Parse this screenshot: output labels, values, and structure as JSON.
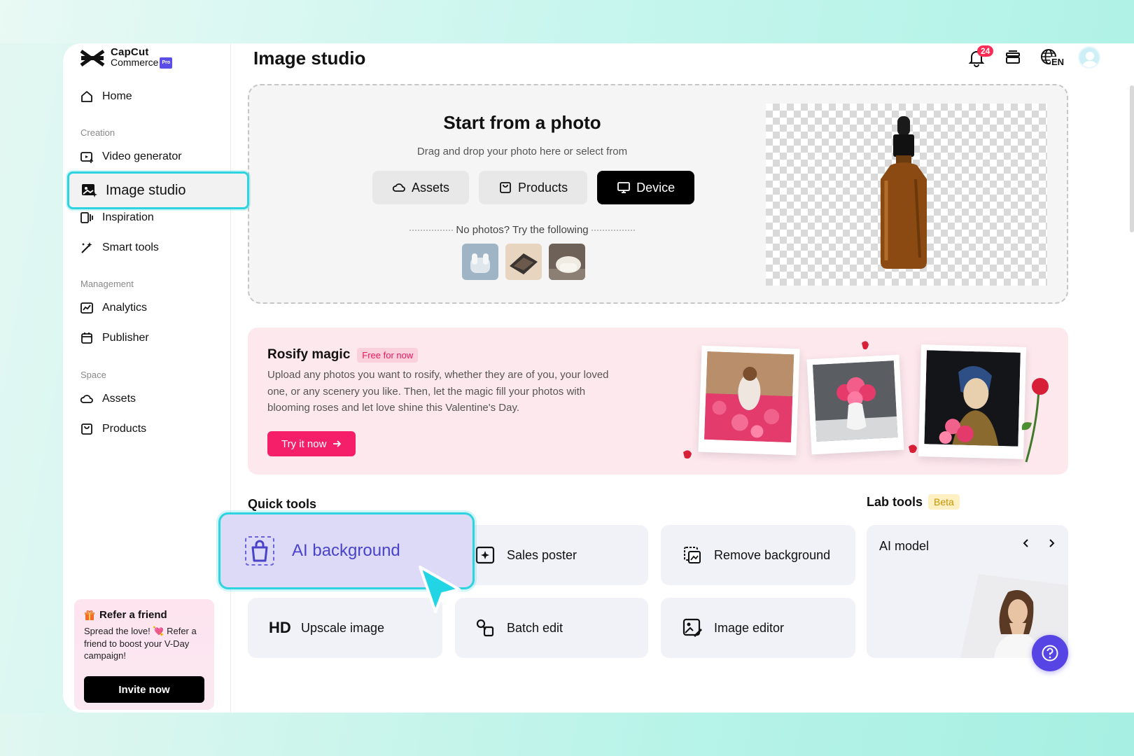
{
  "brand": {
    "line1": "CapCut",
    "line2": "Commerce",
    "badge": "Pro"
  },
  "sidebar": {
    "home": "Home",
    "sections": {
      "creation": "Creation",
      "management": "Management",
      "space": "Space"
    },
    "items": {
      "video_generator": "Video generator",
      "image_studio": "Image studio",
      "inspiration": "Inspiration",
      "smart_tools": "Smart tools",
      "analytics": "Analytics",
      "publisher": "Publisher",
      "assets": "Assets",
      "products": "Products"
    },
    "refer": {
      "title": "Refer a friend",
      "text": "Spread the love! 💘 Refer a friend to boost your V-Day campaign!",
      "button": "Invite now"
    }
  },
  "header": {
    "title": "Image studio",
    "notifications": "24",
    "language": "EN"
  },
  "upload": {
    "title": "Start from a photo",
    "subtitle": "Drag and drop your photo here or select from",
    "buttons": {
      "assets": "Assets",
      "products": "Products",
      "device": "Device"
    },
    "try_text": "No photos? Try the following"
  },
  "rosify": {
    "title": "Rosify magic",
    "badge": "Free for now",
    "text": "Upload any photos you want to rosify, whether they are of you, your loved one, or any scenery you like. Then, let the magic fill your photos with blooming roses and let love shine this Valentine's Day.",
    "button": "Try it now"
  },
  "quick_tools": {
    "title": "Quick tools",
    "items": {
      "ai_background": "AI background",
      "sales_poster": "Sales poster",
      "remove_background": "Remove background",
      "upscale_image": "Upscale image",
      "batch_edit": "Batch edit",
      "image_editor": "Image editor",
      "hd": "HD"
    }
  },
  "lab_tools": {
    "title": "Lab tools",
    "badge": "Beta",
    "card_title": "AI model"
  },
  "colors": {
    "accent": "#2ed3e0",
    "brand_purple": "#5645e4",
    "rose": "#f41f68"
  }
}
